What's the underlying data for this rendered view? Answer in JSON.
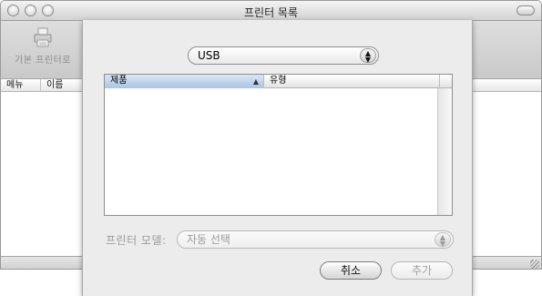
{
  "window": {
    "title": "프린터 목록"
  },
  "toolbar": {
    "default_printer_label": "기본 프린터로"
  },
  "list": {
    "columns": [
      "메뉴",
      "이름"
    ]
  },
  "sheet": {
    "connection_popup": {
      "selected": "USB"
    },
    "table": {
      "columns": [
        {
          "label": "제품",
          "sorted": true,
          "sort_icon": "▲"
        },
        {
          "label": "유형",
          "sorted": false
        }
      ]
    },
    "model": {
      "label": "프린터 모델:",
      "popup_value": "자동 선택"
    },
    "buttons": {
      "cancel": "취소",
      "add": "추가"
    }
  },
  "icons": {
    "printer": "printer-icon",
    "popup_arrows": "updown-arrows-icon"
  }
}
